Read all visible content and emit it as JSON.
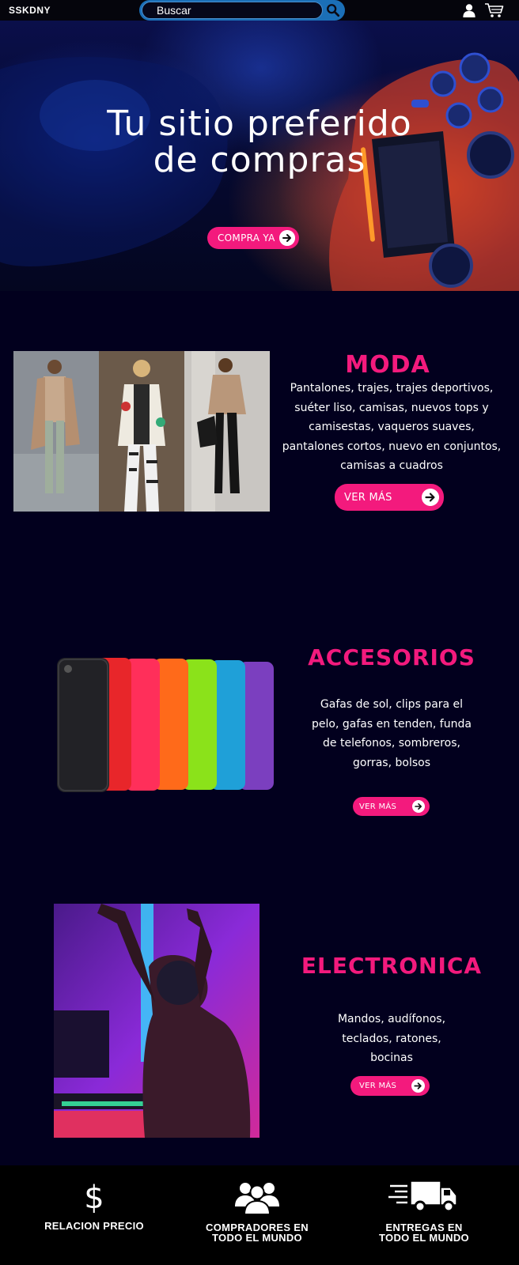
{
  "header": {
    "logo": "SSKDNY",
    "search": {
      "placeholder": "Buscar"
    },
    "icons": [
      "user-icon",
      "cart-icon",
      "search-icon"
    ]
  },
  "hero": {
    "title_line1": "Tu sitio preferido",
    "title_line2": "de compras",
    "cta_label": "COMPRA YA"
  },
  "sections": [
    {
      "title": "MODA",
      "description": "Pantalones, trajes, trajes deportivos, suéter liso, camisas, nuevos tops y camisestas, vaqueros suaves, pantalones cortos, nuevo en conjuntos, camisas a cuadros",
      "button_label": "VER MÁS"
    },
    {
      "title": "ACCESORIOS",
      "description": "Gafas de sol, clips para el pelo, gafas en tenden, funda de telefonos, sombreros, gorras, bolsos",
      "button_label": "VER MÁS"
    },
    {
      "title": "ELECTRONICA",
      "description": "Mandos, audífonos, teclados, ratones, bocinas",
      "button_label": "VER MÁS"
    }
  ],
  "features": [
    {
      "icon": "dollar-icon",
      "label_line1": "RELACION PRECIO",
      "label_line2": ""
    },
    {
      "icon": "users-icon",
      "label_line1": "COMPRADORES EN",
      "label_line2": "TODO EL MUNDO"
    },
    {
      "icon": "delivery-truck-icon",
      "label_line1": "ENTREGAS EN",
      "label_line2": "TODO EL MUNDO"
    }
  ],
  "colors": {
    "accent": "#f31a7d",
    "background": "#02001e",
    "topbar": "#05050c",
    "footer": "#000000",
    "search_border": "#1b6fb7"
  }
}
